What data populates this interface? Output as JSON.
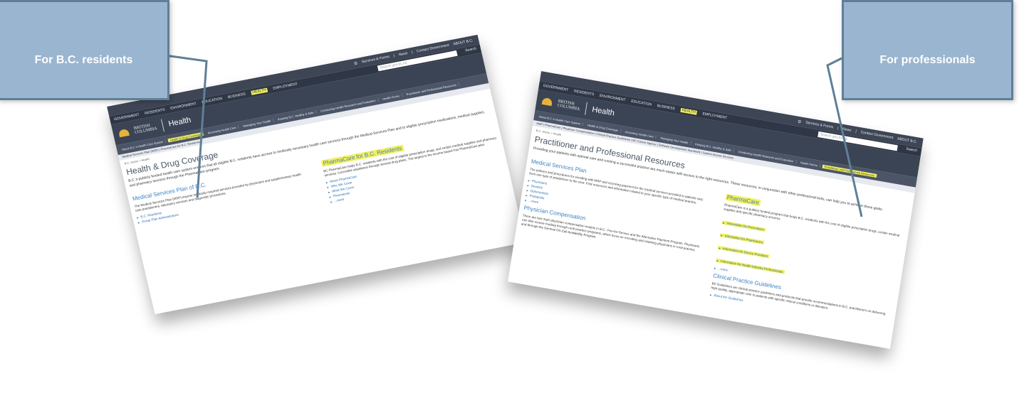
{
  "callouts": {
    "left": "For B.C. residents",
    "right": "For professionals"
  },
  "left_page": {
    "util": {
      "services": "Services & Forms",
      "news": "News",
      "contact": "Contact Government",
      "about": "ABOUT B.C."
    },
    "search": {
      "placeholder": "Search gov.bc.ca",
      "label": "Search"
    },
    "topnav": [
      "GOVERNMENT",
      "RESIDENTS",
      "ENVIRONMENT",
      "EDUCATION",
      "BUSINESS",
      "HEALTH",
      "EMPLOYMENT"
    ],
    "brand": {
      "line1": "BRITISH",
      "line2": "COLUMBIA",
      "title": "Health"
    },
    "subnav": [
      "About B.C.'s Health Care System",
      "Health & Drug Coverage",
      "Accessing Health Care",
      "Managing Your Health",
      "Keeping B.C. Healthy & Safe",
      "Conducting Health Research and Evaluation",
      "Health Forms",
      "Practitioner and Professional Resources"
    ],
    "subnav2": "Medical Services Plan (MSP) | PharmaCare for B.C. Residents",
    "breadcrumb": "B.C. Home > Health",
    "title": "Health & Drug Coverage",
    "intro": "B.C.'s publicly funded health care system ensures that all eligible B.C. residents have access to medically necessary health care services through the Medical Services Plan and to eligible prescription medications, medical supplies, and pharmacy services through the PharmaCare program.",
    "col1": {
      "heading": "Medical Services Plan of B.C.",
      "body": "The Medical Services Plan (MSP) insures medically required services provided by physicians and supplementary health care practitioners, laboratory services and diagnostic procedures.",
      "links": [
        "B.C. Residents",
        "Group Plan Administrators"
      ]
    },
    "col2": {
      "heading": "PharmaCare for B.C. Residents",
      "body": "BC PharmaCare helps B.C. residents with the cost of eligible prescription drugs, and certain medical supplies and pharmacy services. It provides assistance through several drug plans. The largest is the income based Fair PharmaCare plan.",
      "links": [
        "About PharmaCare",
        "Who We Cover",
        "What We Cover",
        "Pharmacies",
        "...more"
      ]
    }
  },
  "right_page": {
    "util": {
      "services": "Services & Forms",
      "news": "News",
      "contact": "Contact Government",
      "about": "ABOUT B.C."
    },
    "search": {
      "placeholder": "Search gov.bc.ca",
      "label": "Search"
    },
    "topnav": [
      "GOVERNMENT",
      "RESIDENTS",
      "ENVIRONMENT",
      "EDUCATION",
      "BUSINESS",
      "HEALTH",
      "EMPLOYMENT"
    ],
    "brand": {
      "line1": "BRITISH",
      "line2": "COLUMBIA",
      "title": "Health"
    },
    "subnav": [
      "About B.C.'s Health Care System",
      "Health & Drug Coverage",
      "Accessing Health Care",
      "Managing Your Health",
      "Keeping B.C. Healthy & Safe",
      "Conducting Health Research and Evaluation",
      "Health Forms",
      "Practitioner and Professional Resources"
    ],
    "subnav2": "MSP | PharmaCare | Physician Compensation | Clinical Practice Guidelines | BC Cancer Agency | Software Development Standards | System Access Services",
    "breadcrumb": "B.C. Home > Health",
    "title": "Practitioner and Professional Resources",
    "intro": "Providing your patients with optimal care and running a successful practice are much easier with access to the right resources. These resources, in conjunction with other professional tools, can help you to achieve those goals.",
    "col1": {
      "heading": "Medical Services Plan",
      "body": "The policies and procedures for enrolling with MSP and receiving payment for the medical services provided to patients vary from one type of practitioner to the next. Find resources and information related to your specific type of medical practice.",
      "links": [
        "Physicians",
        "Dentists",
        "Optometrists",
        "Podiatrists",
        "...more"
      ]
    },
    "col1b": {
      "heading": "Physician Compensation",
      "body": "There are two main physician compensation models in B.C.: Fee-for-Service and the Alternative Payment Program. Physicians can also receive funding through rural practice programs, which focus on recruiting and retaining physicians in rural practice, and through the General On-Call Availability Program."
    },
    "col2": {
      "heading": "PharmaCare",
      "body": "PharmaCare is a publicly funded program that helps B.C. residents with the cost of eligible prescription drugs, certain medical supplies and specific pharmacy services.",
      "links": [
        "Information for Prescribers",
        "Information for Pharmacies",
        "Information for Device Providers",
        "Information for Health Industry Professionals",
        "...more"
      ]
    },
    "col2b": {
      "heading": "Clinical Practice Guidelines",
      "body": "BC Guidelines are clinical practice guidelines and protocols that provide recommendations to B.C. practitioners on delivering high quality, appropriate care to patients with specific clinical conditions or diseases.",
      "links": [
        "About the Guidelines"
      ]
    }
  }
}
